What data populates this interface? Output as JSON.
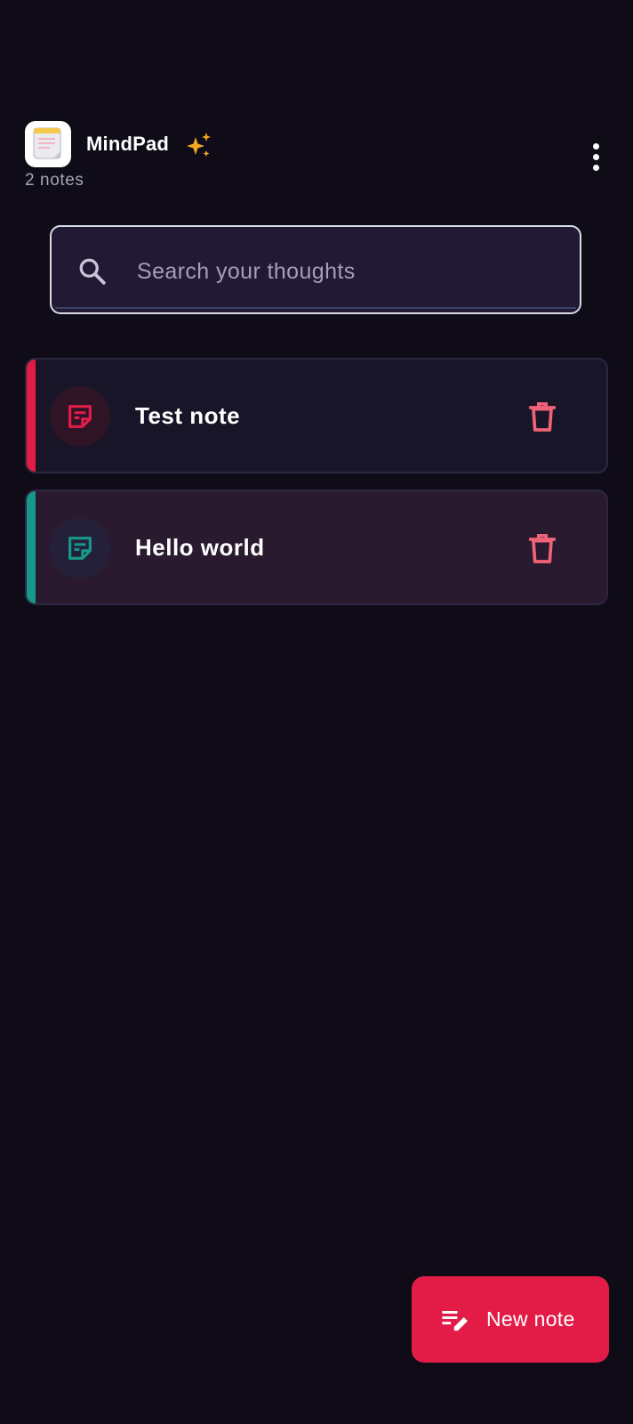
{
  "header": {
    "app_title": "MindPad",
    "note_count": "2 notes"
  },
  "search": {
    "placeholder": "Search your thoughts",
    "value": ""
  },
  "notes": [
    {
      "title": "Test note",
      "accent_color": "#e31c47",
      "icon_color": "#e31c47",
      "icon_bg": "#2f1426",
      "card_bg": "#191528",
      "icon": "sticky-note-icon"
    },
    {
      "title": "Hello world",
      "accent_color": "#16998a",
      "icon_color": "#16998a",
      "icon_bg": "#25203a",
      "card_bg": "#2a1a2f",
      "icon": "sticky-note-icon"
    }
  ],
  "fab": {
    "label": "New note",
    "color": "#e31c47",
    "icon": "edit-note-icon"
  },
  "colors": {
    "background": "#0f0c18",
    "sparkle": "#f5a623",
    "delete_icon": "#f06277"
  }
}
